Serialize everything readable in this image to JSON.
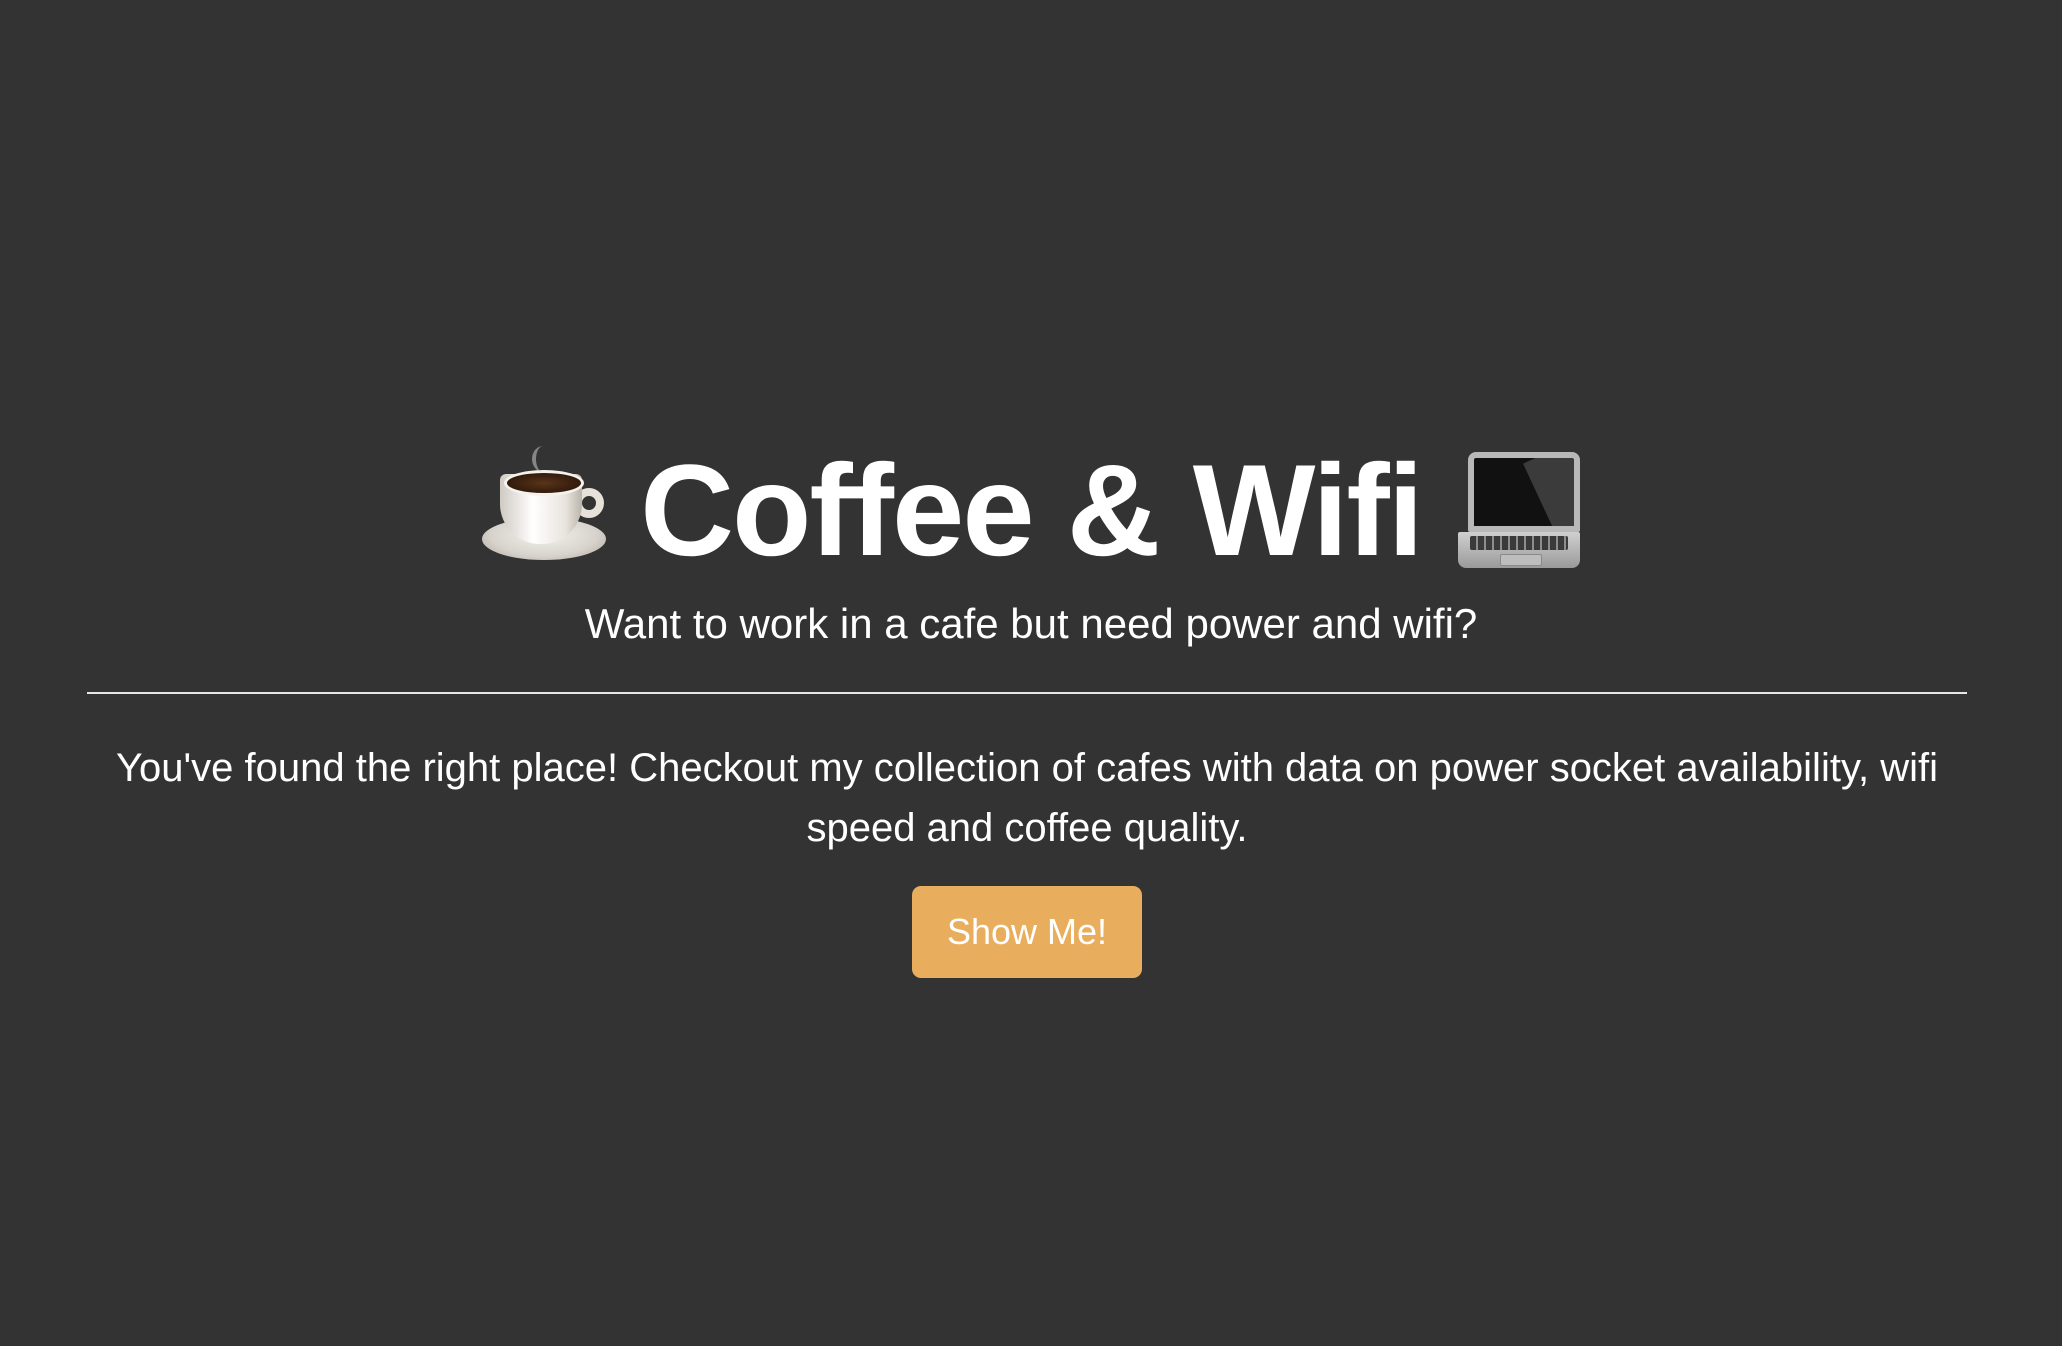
{
  "hero": {
    "title": "Coffee & Wifi",
    "leading_icon": "hot-beverage-icon",
    "trailing_icon": "laptop-icon",
    "subtitle": "Want to work in a cafe but need power and wifi?",
    "lead": "You've found the right place! Checkout my collection of cafes with data on power socket availability, wifi speed and coffee quality.",
    "cta_label": "Show Me!"
  },
  "colors": {
    "background": "#333333",
    "text": "#ffffff",
    "cta_background": "#e8ae5e",
    "divider": "#e6e6e6"
  }
}
